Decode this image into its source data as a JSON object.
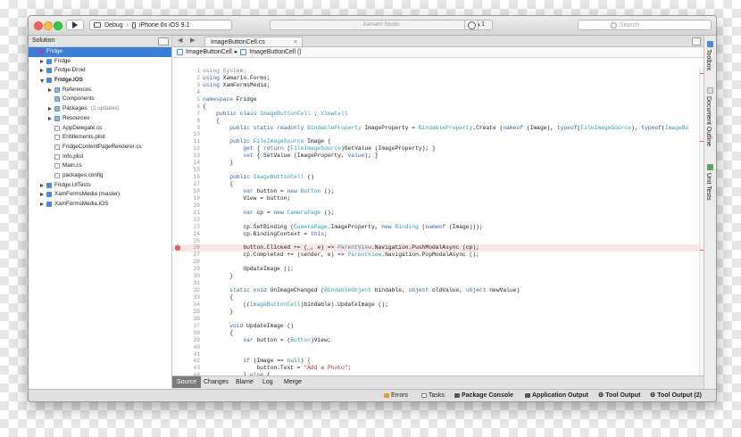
{
  "toolbar": {
    "config": "Debug",
    "separator": "›",
    "device": "iPhone 6s iOS 9.1",
    "status_text": "Xamarin Studio",
    "warnings": "▲1",
    "search_placeholder": "Search"
  },
  "solution_pad": {
    "title": "Solution",
    "items": [
      {
        "label": "Fridge",
        "depth": 0,
        "icon": "sln",
        "selected": true
      },
      {
        "label": "Fridge",
        "depth": 1,
        "icon": "proj",
        "arrow": "right"
      },
      {
        "label": "Fridge.Droid",
        "depth": 1,
        "icon": "proj",
        "arrow": "right"
      },
      {
        "label": "Fridge.iOS",
        "depth": 1,
        "icon": "proj",
        "arrow": "down",
        "bold": true
      },
      {
        "label": "References",
        "depth": 2,
        "icon": "folder",
        "arrow": "right"
      },
      {
        "label": "Components",
        "depth": 2,
        "icon": "folder"
      },
      {
        "label": "Packages",
        "extra": "(2 updates)",
        "depth": 2,
        "icon": "folder",
        "arrow": "right"
      },
      {
        "label": "Resources",
        "depth": 2,
        "icon": "folder",
        "arrow": "right"
      },
      {
        "label": "AppDelegate.cs",
        "depth": 2,
        "icon": "file"
      },
      {
        "label": "Entitlements.plist",
        "depth": 2,
        "icon": "file"
      },
      {
        "label": "FridgeContentPageRenderer.cs",
        "depth": 2,
        "icon": "file"
      },
      {
        "label": "Info.plist",
        "depth": 2,
        "icon": "file"
      },
      {
        "label": "Main.cs",
        "depth": 2,
        "icon": "file"
      },
      {
        "label": "packages.config",
        "depth": 2,
        "icon": "file"
      },
      {
        "label": "Fridge.UITests",
        "depth": 1,
        "icon": "proj",
        "arrow": "right"
      },
      {
        "label": "XamFormsMedia (master)",
        "depth": 1,
        "icon": "proj",
        "arrow": "right"
      },
      {
        "label": "XamFormsMedia.iOS",
        "depth": 1,
        "icon": "proj",
        "arrow": "right"
      }
    ]
  },
  "editor": {
    "tab_title": "ImageButtonCell.cs",
    "close_glyph": "×",
    "breadcrumb": [
      "ImageButtonCell",
      "ImageButtonCell ()"
    ],
    "breadcrumb_sep": "▸",
    "lines": [
      {
        "n": "1",
        "code": "<span class='c'>using System;</span>"
      },
      {
        "n": "2",
        "code": "<span class='k'>using</span> Xamarin.Forms;"
      },
      {
        "n": "3",
        "code": "<span class='k'>using</span> XamFormsMedia;"
      },
      {
        "n": "4",
        "code": ""
      },
      {
        "n": "5",
        "code": "<span class='k'>namespace</span> Fridge"
      },
      {
        "n": "6",
        "code": "{"
      },
      {
        "n": "7",
        "code": "    <span class='k'>public class</span> <span class='t'>ImageButtonCell</span> : <span class='t'>ViewCell</span>"
      },
      {
        "n": "8",
        "code": "    {"
      },
      {
        "n": "9",
        "code": "        <span class='k'>public static readonly</span> <span class='t'>BindableProperty</span> ImageProperty = <span class='t'>BindableProperty</span>.Create (<span class='k'>nameof</span> (Image), <span class='k'>typeof</span>(<span class='t'>FileImageSource</span>), <span class='k'>typeof</span>(<span class='t'>ImageBu</span>"
      },
      {
        "n": "10",
        "code": ""
      },
      {
        "n": "11",
        "code": "        <span class='k'>public</span> <span class='t'>FileImageSource</span> Image {"
      },
      {
        "n": "12",
        "code": "            <span class='k'>get</span> { <span class='k'>return</span> (<span class='t'>FileImageSource</span>)GetValue (ImageProperty); }"
      },
      {
        "n": "13",
        "code": "            <span class='k'>set</span> { SetValue (ImageProperty, <span class='k'>value</span>); }"
      },
      {
        "n": "14",
        "code": "        }"
      },
      {
        "n": "15",
        "code": ""
      },
      {
        "n": "16",
        "code": "        <span class='k'>public</span> <span class='t'>ImageButtonCell</span> ()"
      },
      {
        "n": "17",
        "code": "        {"
      },
      {
        "n": "18",
        "code": "            <span class='k'>var</span> button = <span class='k'>new</span> <span class='t'>Button</span> ();"
      },
      {
        "n": "19",
        "code": "            View = button;"
      },
      {
        "n": "20",
        "code": ""
      },
      {
        "n": "21",
        "code": "            <span class='k'>var</span> cp = <span class='k'>new</span> <span class='t'>CameraPage</span> ();"
      },
      {
        "n": "22",
        "code": ""
      },
      {
        "n": "23",
        "code": "            cp.SetBinding (<span class='t'>CameraPage</span>.ImageProperty, <span class='k'>new</span> <span class='t'>Binding</span> (<span class='k'>nameof</span> (Image)));"
      },
      {
        "n": "24",
        "code": "            cp.BindingContext = <span class='k'>this</span>;"
      },
      {
        "n": "25",
        "code": ""
      },
      {
        "n": "26",
        "code": "            button.Clicked += (_, e) => <span class='t'>ParentView</span>.Navigation.PushModalAsync (cp);",
        "breakpoint": true
      },
      {
        "n": "27",
        "code": "            cp.Completed += (sender, e) => <span class='t'>ParentView</span>.Navigation.PopModalAsync ();"
      },
      {
        "n": "28",
        "code": ""
      },
      {
        "n": "29",
        "code": "            UpdateImage ();"
      },
      {
        "n": "30",
        "code": "        }"
      },
      {
        "n": "31",
        "code": ""
      },
      {
        "n": "32",
        "code": "        <span class='k'>static void</span> OnImageChanged (<span class='t'>BindableObject</span> bindable, <span class='k'>object</span> oldValue, <span class='k'>object</span> newValue)"
      },
      {
        "n": "33",
        "code": "        {"
      },
      {
        "n": "34",
        "code": "            ((<span class='t'>ImageButtonCell</span>)bindable).UpdateImage ();"
      },
      {
        "n": "35",
        "code": "        }"
      },
      {
        "n": "36",
        "code": ""
      },
      {
        "n": "37",
        "code": "        <span class='k'>void</span> UpdateImage ()"
      },
      {
        "n": "38",
        "code": "        {"
      },
      {
        "n": "39",
        "code": "            <span class='k'>var</span> button = (<span class='t'>Button</span>)View;"
      },
      {
        "n": "40",
        "code": ""
      },
      {
        "n": "41",
        "code": ""
      },
      {
        "n": "42",
        "code": "            <span class='k'>if</span> (Image == <span class='k'>null</span>) {"
      },
      {
        "n": "43",
        "code": "                button.Text = <span class='s'>\"Add a Photo\"</span>;"
      },
      {
        "n": "44",
        "code": "            } <span class='k'>else</span> {"
      }
    ],
    "source_tabs": [
      "Source",
      "Changes",
      "Blame",
      "Log",
      "Merge"
    ]
  },
  "right_pads": [
    "Toolbox",
    "Document Outline",
    "Unit Tests"
  ],
  "statusbar": {
    "items": [
      "Errors",
      "Tasks",
      "Package Console",
      "Application Output",
      "Tool Output",
      "Tool Output (2)"
    ]
  },
  "colors": {
    "selection": "#3d7fd7",
    "keyword": "#3364a4",
    "type": "#2a9bb0",
    "breakpoint_line": "#fbe4e4",
    "breakpoint_dot": "#e07070"
  }
}
